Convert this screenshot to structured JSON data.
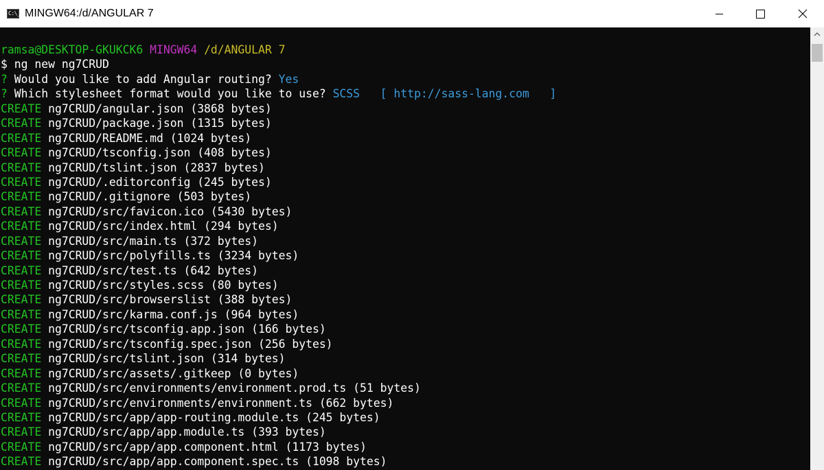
{
  "window": {
    "title": "MINGW64:/d/ANGULAR 7",
    "icon_label": "C:\\_"
  },
  "colors": {
    "background": "#0c0c0c",
    "green": "#22c322",
    "magenta": "#c133c1",
    "yellow": "#c9bb28",
    "blue": "#3d9bdb",
    "white": "#ffffff"
  },
  "prompt": {
    "user_host": "ramsa@DESKTOP-GKUKCK6",
    "shell": "MINGW64",
    "path": "/d/ANGULAR 7",
    "symbol": "$",
    "command": "ng new ng7CRUD"
  },
  "questions": [
    {
      "mark": "?",
      "text": "Would you like to add Angular routing?",
      "answer": "Yes",
      "extra": ""
    },
    {
      "mark": "?",
      "text": "Which stylesheet format would you like to use?",
      "answer": "SCSS",
      "extra": "  [ http://sass-lang.com   ]"
    }
  ],
  "create_label": "CREATE",
  "created_files": [
    "ng7CRUD/angular.json (3868 bytes)",
    "ng7CRUD/package.json (1315 bytes)",
    "ng7CRUD/README.md (1024 bytes)",
    "ng7CRUD/tsconfig.json (408 bytes)",
    "ng7CRUD/tslint.json (2837 bytes)",
    "ng7CRUD/.editorconfig (245 bytes)",
    "ng7CRUD/.gitignore (503 bytes)",
    "ng7CRUD/src/favicon.ico (5430 bytes)",
    "ng7CRUD/src/index.html (294 bytes)",
    "ng7CRUD/src/main.ts (372 bytes)",
    "ng7CRUD/src/polyfills.ts (3234 bytes)",
    "ng7CRUD/src/test.ts (642 bytes)",
    "ng7CRUD/src/styles.scss (80 bytes)",
    "ng7CRUD/src/browserslist (388 bytes)",
    "ng7CRUD/src/karma.conf.js (964 bytes)",
    "ng7CRUD/src/tsconfig.app.json (166 bytes)",
    "ng7CRUD/src/tsconfig.spec.json (256 bytes)",
    "ng7CRUD/src/tslint.json (314 bytes)",
    "ng7CRUD/src/assets/.gitkeep (0 bytes)",
    "ng7CRUD/src/environments/environment.prod.ts (51 bytes)",
    "ng7CRUD/src/environments/environment.ts (662 bytes)",
    "ng7CRUD/src/app/app-routing.module.ts (245 bytes)",
    "ng7CRUD/src/app/app.module.ts (393 bytes)",
    "ng7CRUD/src/app/app.component.html (1173 bytes)",
    "ng7CRUD/src/app/app.component.spec.ts (1098 bytes)"
  ]
}
